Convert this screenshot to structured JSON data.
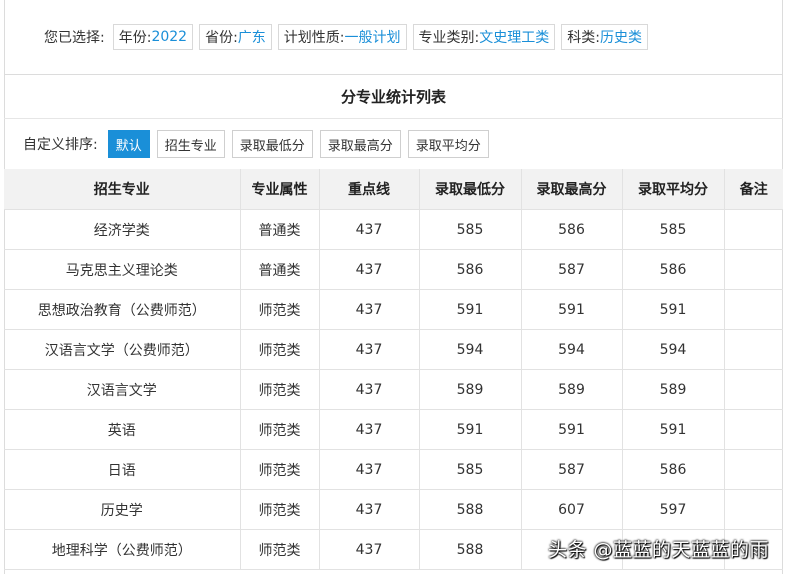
{
  "filters": {
    "label": "您已选择:",
    "chips": [
      {
        "key": "年份:",
        "value": "2022"
      },
      {
        "key": "省份:",
        "value": "广东"
      },
      {
        "key": "计划性质:",
        "value": "一般计划"
      },
      {
        "key": "专业类别:",
        "value": "文史理工类"
      },
      {
        "key": "科类:",
        "value": "历史类"
      }
    ]
  },
  "table_title": "分专业统计列表",
  "sort": {
    "label": "自定义排序:",
    "buttons": [
      "默认",
      "招生专业",
      "录取最低分",
      "录取最高分",
      "录取平均分"
    ],
    "active_index": 0
  },
  "columns": [
    "招生专业",
    "专业属性",
    "重点线",
    "录取最低分",
    "录取最高分",
    "录取平均分",
    "备注"
  ],
  "rows": [
    [
      "经济学类",
      "普通类",
      "437",
      "585",
      "586",
      "585",
      ""
    ],
    [
      "马克思主义理论类",
      "普通类",
      "437",
      "586",
      "587",
      "586",
      ""
    ],
    [
      "思想政治教育（公费师范）",
      "师范类",
      "437",
      "591",
      "591",
      "591",
      ""
    ],
    [
      "汉语言文学（公费师范）",
      "师范类",
      "437",
      "594",
      "594",
      "594",
      ""
    ],
    [
      "汉语言文学",
      "师范类",
      "437",
      "589",
      "589",
      "589",
      ""
    ],
    [
      "英语",
      "师范类",
      "437",
      "591",
      "591",
      "591",
      ""
    ],
    [
      "日语",
      "师范类",
      "437",
      "585",
      "587",
      "586",
      ""
    ],
    [
      "历史学",
      "师范类",
      "437",
      "588",
      "607",
      "597",
      ""
    ],
    [
      "地理科学（公费师范）",
      "师范类",
      "437",
      "588",
      "",
      "",
      ""
    ]
  ],
  "watermark": "头条 @蓝蓝的天蓝蓝的雨",
  "colors": {
    "accent": "#1a8fd8",
    "header_bg": "#f2f2f2",
    "border": "#e2e2e2"
  }
}
